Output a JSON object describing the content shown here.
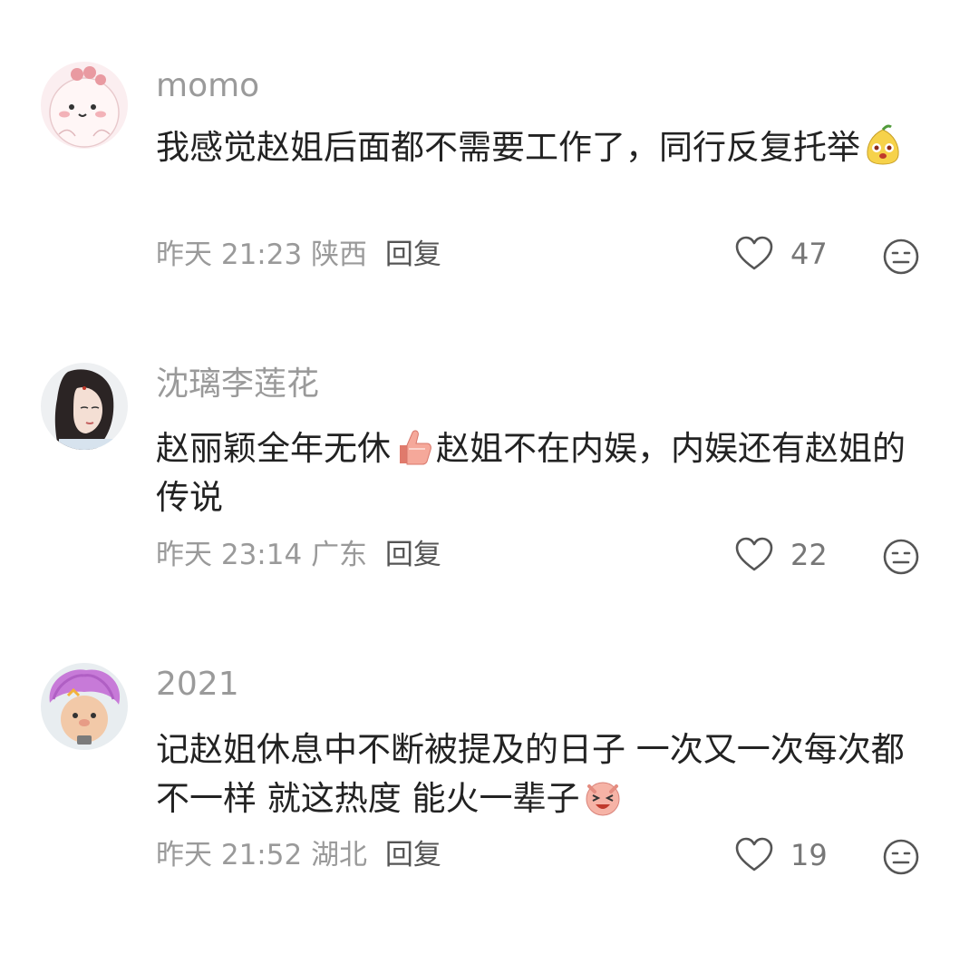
{
  "comments": [
    {
      "username": "momo",
      "text_before": "我感觉赵姐后面都不需要工作了，同行反复托举",
      "emoji": "yellow-pear-face",
      "text_after": "",
      "time": "昨天 21:23",
      "location": "陕西",
      "reply_label": "回复",
      "likes": "47"
    },
    {
      "username": "沈璃李莲花",
      "text_before": "赵丽颖全年无休",
      "emoji": "thumbs-up",
      "text_after": "赵姐不在内娱，内娱还有赵姐的传说",
      "time": "昨天 23:14",
      "location": "广东",
      "reply_label": "回复",
      "likes": "22"
    },
    {
      "username": "2021",
      "text_before": "记赵姐休息中不断被提及的日子 一次又一次每次都不一样 就这热度 能火一辈子",
      "emoji": "pink-laughing-pig",
      "text_after": "",
      "time": "昨天 21:52",
      "location": "湖北",
      "reply_label": "回复",
      "likes": "19"
    }
  ],
  "icons": {
    "like": "heart-outline-icon",
    "dislike": "neutral-face-icon"
  },
  "colors": {
    "username": "#9a9a9a",
    "text": "#222222",
    "meta": "#9a9a9a"
  }
}
